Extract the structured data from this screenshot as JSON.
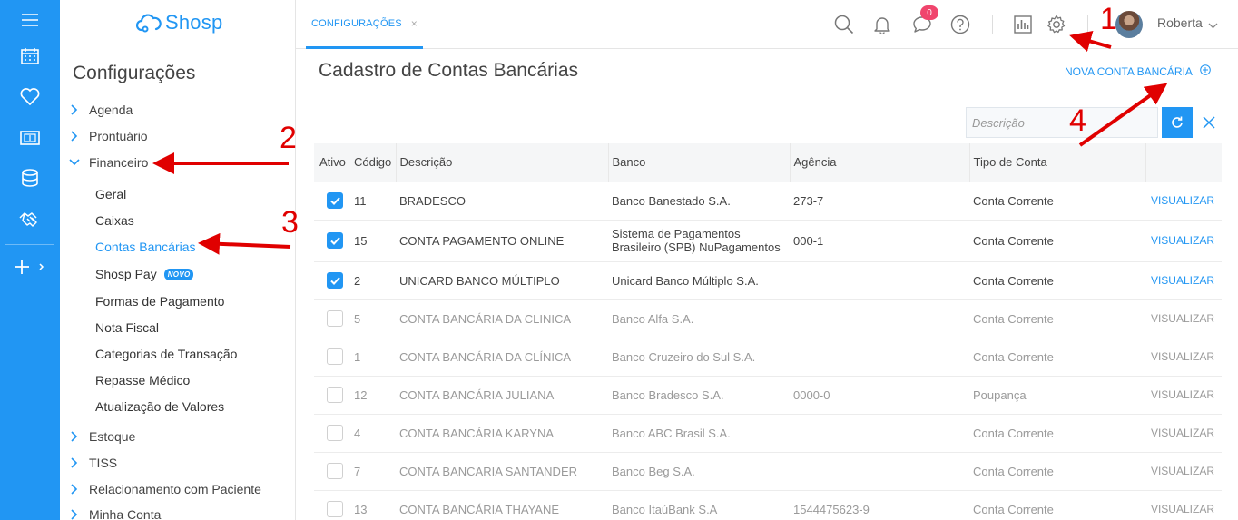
{
  "app": {
    "name": "Shosp"
  },
  "sidebar": {
    "title": "Configurações",
    "items": [
      {
        "label": "Agenda"
      },
      {
        "label": "Prontuário"
      },
      {
        "label": "Financeiro"
      },
      {
        "label": "Estoque"
      },
      {
        "label": "TISS"
      },
      {
        "label": "Relacionamento com Paciente"
      },
      {
        "label": "Minha Conta"
      }
    ],
    "financeiro_sub": [
      {
        "label": "Geral"
      },
      {
        "label": "Caixas"
      },
      {
        "label": "Contas Bancárias",
        "active": true
      },
      {
        "label": "Shosp Pay",
        "badge": "NOVO"
      },
      {
        "label": "Formas de Pagamento"
      },
      {
        "label": "Nota Fiscal"
      },
      {
        "label": "Categorias de Transação"
      },
      {
        "label": "Repasse Médico"
      },
      {
        "label": "Atualização de Valores"
      }
    ]
  },
  "topbar": {
    "tab_label": "CONFIGURAÇÕES",
    "tab_close": "×",
    "chat_count": "0",
    "user_name": "Roberta"
  },
  "main": {
    "title": "Cadastro de Contas Bancárias",
    "new_button": "NOVA CONTA BANCÁRIA",
    "search_placeholder": "Descrição"
  },
  "table": {
    "headers": {
      "ativo": "Ativo",
      "codigo": "Código",
      "descricao": "Descrição",
      "banco": "Banco",
      "agencia": "Agência",
      "tipo": "Tipo de Conta"
    },
    "action_label": "VISUALIZAR",
    "rows": [
      {
        "ativo": true,
        "codigo": "11",
        "descricao": "BRADESCO",
        "banco": "Banco Banestado S.A.",
        "agencia": "273-7",
        "tipo": "Conta Corrente"
      },
      {
        "ativo": true,
        "codigo": "15",
        "descricao": "CONTA PAGAMENTO ONLINE",
        "banco": "Sistema de Pagamentos Brasileiro (SPB) NuPagamentos",
        "agencia": "000-1",
        "tipo": "Conta Corrente"
      },
      {
        "ativo": true,
        "codigo": "2",
        "descricao": "UNICARD BANCO MÚLTIPLO",
        "banco": "Unicard Banco Múltiplo S.A.",
        "agencia": "",
        "tipo": "Conta Corrente"
      },
      {
        "ativo": false,
        "codigo": "5",
        "descricao": "CONTA BANCÁRIA DA CLINICA",
        "banco": "Banco Alfa S.A.",
        "agencia": "",
        "tipo": "Conta Corrente"
      },
      {
        "ativo": false,
        "codigo": "1",
        "descricao": "CONTA BANCÁRIA DA CLÍNICA",
        "banco": "Banco Cruzeiro do Sul S.A.",
        "agencia": "",
        "tipo": "Conta Corrente"
      },
      {
        "ativo": false,
        "codigo": "12",
        "descricao": "CONTA BANCÁRIA JULIANA",
        "banco": "Banco Bradesco S.A.",
        "agencia": "0000-0",
        "tipo": "Poupança"
      },
      {
        "ativo": false,
        "codigo": "4",
        "descricao": "CONTA BANCÁRIA KARYNA",
        "banco": "Banco ABC Brasil S.A.",
        "agencia": "",
        "tipo": "Conta Corrente"
      },
      {
        "ativo": false,
        "codigo": "7",
        "descricao": "CONTA BANCARIA SANTANDER",
        "banco": "Banco Beg S.A.",
        "agencia": "",
        "tipo": "Conta Corrente"
      },
      {
        "ativo": false,
        "codigo": "13",
        "descricao": "CONTA BANCÁRIA THAYANE",
        "banco": "Banco ItaúBank S.A",
        "agencia": "1544475623-9",
        "tipo": "Conta Corrente"
      }
    ]
  },
  "annotations": {
    "n1": "1",
    "n2": "2",
    "n3": "3",
    "n4": "4"
  },
  "colors": {
    "accent": "#2196f3",
    "annotation": "#e00000",
    "badge": "#f0456d"
  },
  "icons": [
    "menu-icon",
    "calendar-icon",
    "heart-icon",
    "money-icon",
    "database-icon",
    "handshake-icon",
    "plus-icon",
    "search-icon",
    "bell-icon",
    "chat-icon",
    "help-icon",
    "chart-icon",
    "gear-icon",
    "refresh-icon",
    "close-icon"
  ]
}
